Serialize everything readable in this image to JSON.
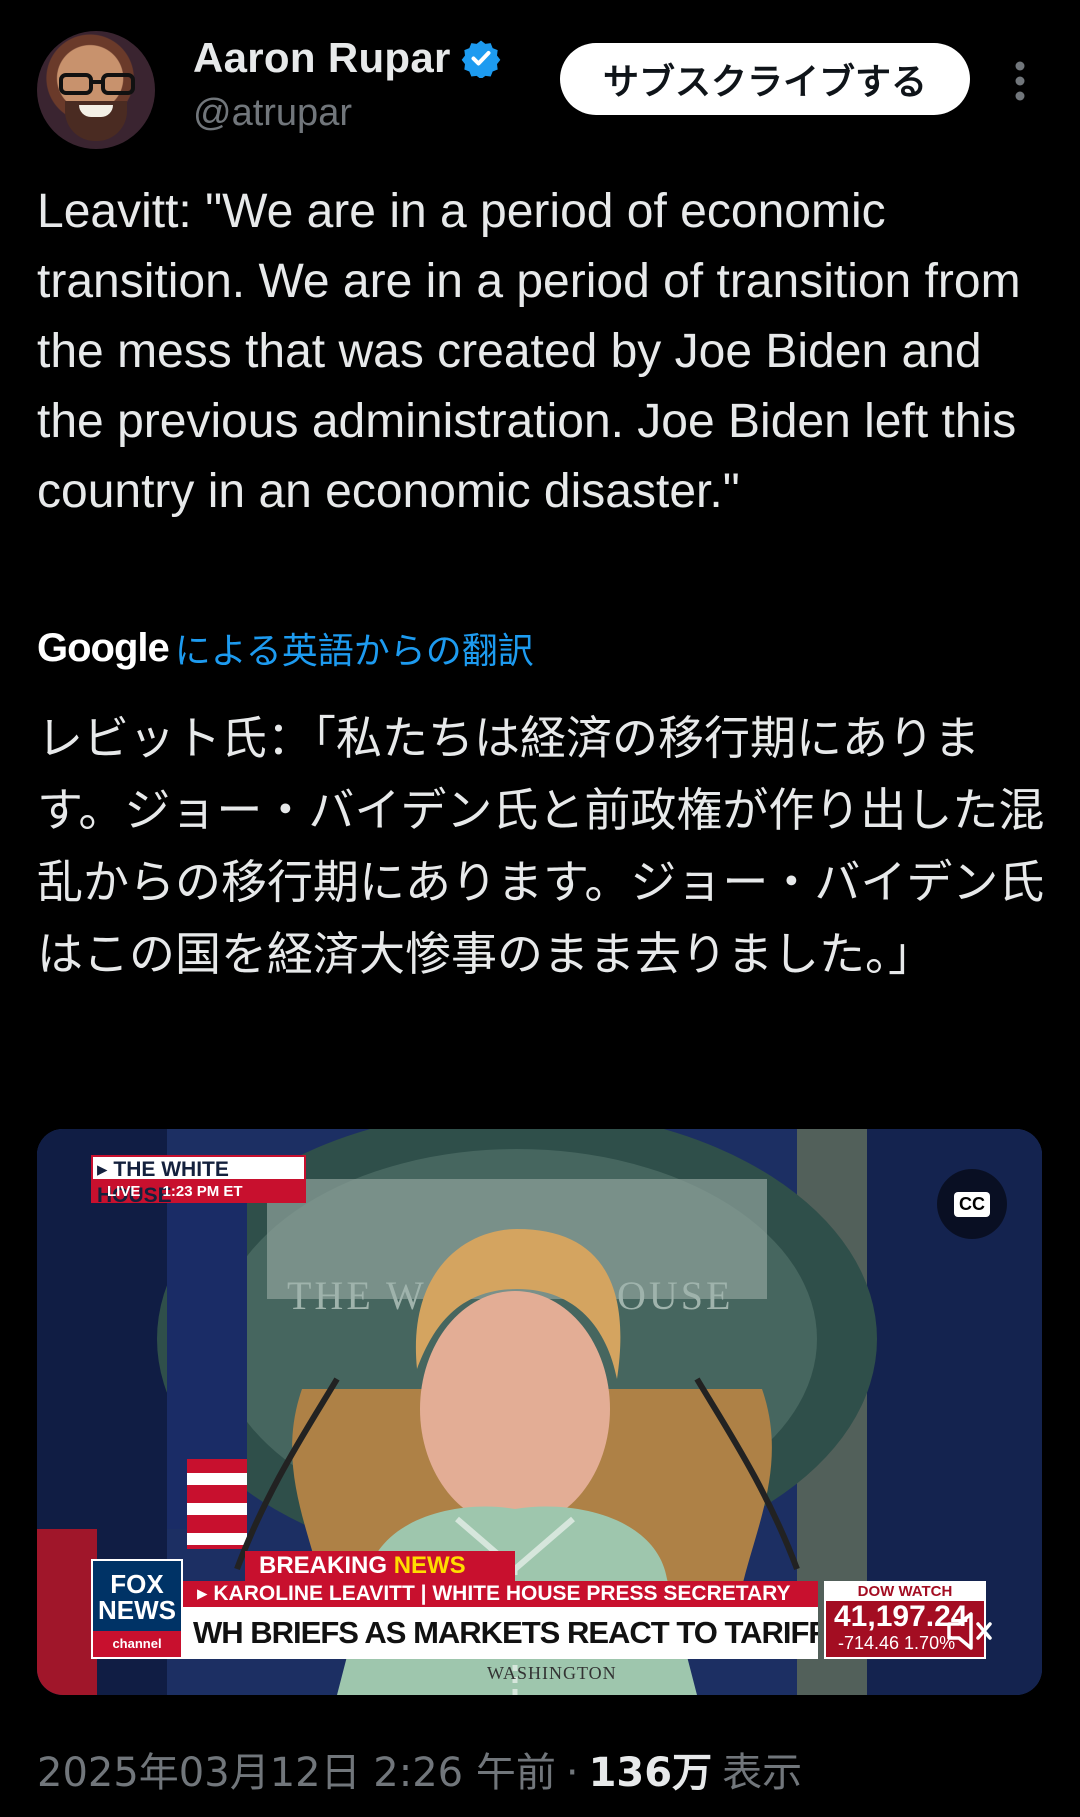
{
  "author": {
    "display_name": "Aaron Rupar",
    "handle": "@atrupar",
    "verified": true,
    "verified_color": "#1d9bf0",
    "avatar_icon": "avatar-photo"
  },
  "header": {
    "subscribe_label": "サブスクライブする",
    "more_icon": "more-vertical-icon"
  },
  "tweet": {
    "text": "Leavitt: \"We are in a period of economic transition. We are in a period of transition from the mess that was created by Joe Biden and the previous administration. Joe Biden left this country in an economic disaster.\"",
    "translation_provider": "Google",
    "translation_link": "による英語からの翻訳",
    "translated_text": "レビット氏：「私たちは経済の移行期にあります。ジョー・バイデン氏と前政権が作り出した混乱からの移行期にあります。ジョー・バイデン氏はこの国を経済大惨事のまま去りました。」"
  },
  "video": {
    "cc_label": "CC",
    "mute_icon": "volume-muted-icon",
    "overlay": {
      "bug_title_1": "THE WHITE HOUSE",
      "bug_live": "LIVE",
      "bug_time": "1:23 PM ET",
      "network_logo_1": "FOX",
      "network_logo_2": "NEWS",
      "network_logo_3": "channel",
      "breaking_1": "BREAKING",
      "breaking_2": "NEWS",
      "nameplate": "▸ KAROLINE LEAVITT | WHITE HOUSE PRESS SECRETARY",
      "headline": "WH BRIEFS AS MARKETS REACT TO TARIFF UNCERTAINTY",
      "dow_label": "DOW WATCH",
      "dow_value": "41,197.24",
      "dow_change": "-714.46 1.70%",
      "location": "WASHINGTON"
    }
  },
  "meta": {
    "timestamp": "2025年03月12日 2:26 午前",
    "separator": "·",
    "views": "136万",
    "views_label": "表示"
  }
}
